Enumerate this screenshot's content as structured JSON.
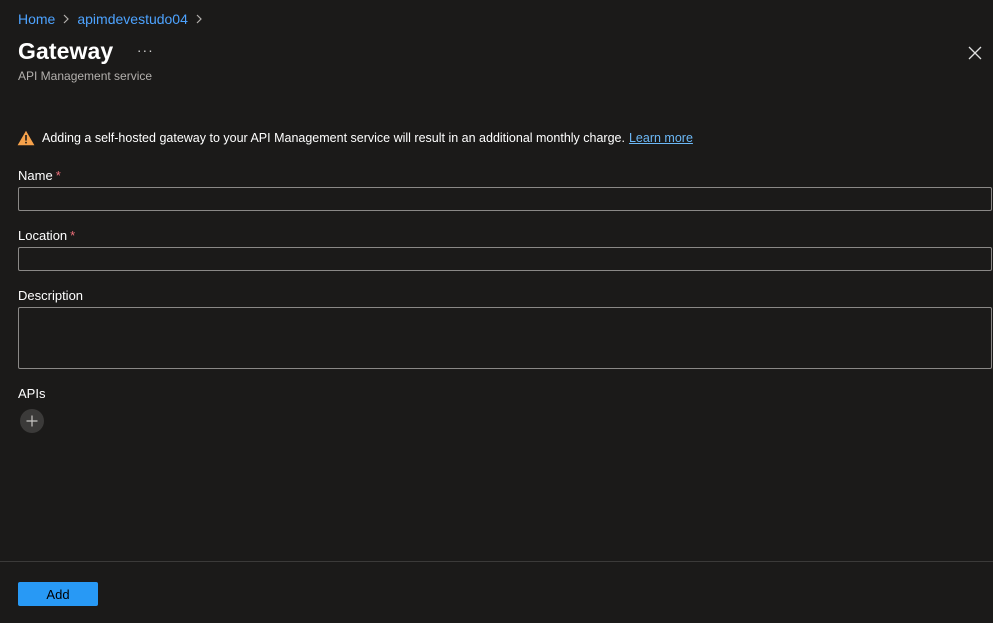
{
  "breadcrumb": {
    "items": [
      {
        "label": "Home"
      },
      {
        "label": "apimdevestudo04"
      }
    ]
  },
  "header": {
    "title": "Gateway",
    "more_label": "···",
    "subtitle": "API Management service"
  },
  "warning": {
    "text": "Adding a self-hosted gateway to your API Management service will result in an additional monthly charge.",
    "link": "Learn more"
  },
  "form": {
    "name": {
      "label": "Name",
      "required_mark": "*",
      "value": ""
    },
    "location": {
      "label": "Location",
      "required_mark": "*",
      "value": ""
    },
    "description": {
      "label": "Description",
      "value": ""
    },
    "apis": {
      "label": "APIs"
    }
  },
  "footer": {
    "add_label": "Add"
  },
  "colors": {
    "background": "#1b1a19",
    "link": "#4da3ff",
    "primary_button": "#2899f5",
    "warning_icon": "#f7a24b",
    "required": "#f1707b"
  },
  "icons": {
    "breadcrumb_separator": "chevron-right-icon",
    "close": "close-icon",
    "warning": "warning-icon",
    "add_api": "plus-icon"
  }
}
